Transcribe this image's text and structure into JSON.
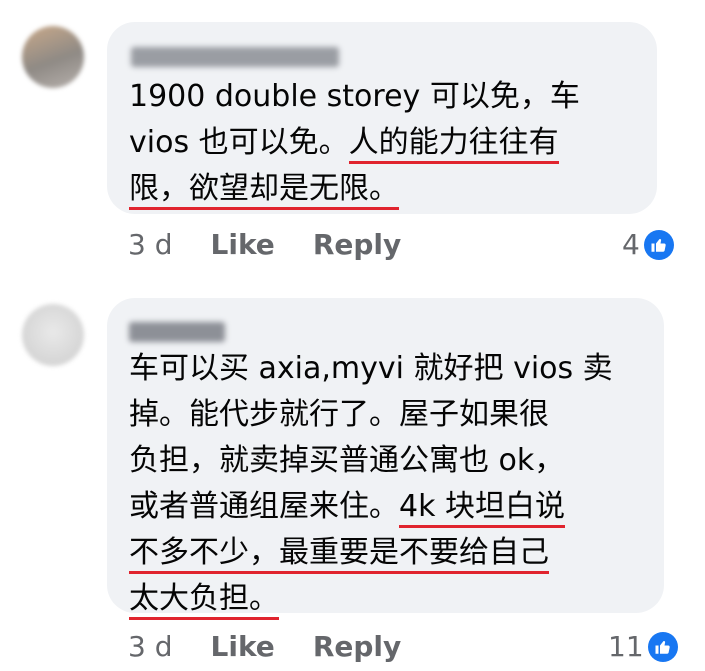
{
  "comments": [
    {
      "text_lines": [
        {
          "parts": [
            {
              "text": "1900 double storey 可以免，车"
            }
          ]
        },
        {
          "parts": [
            {
              "text": "vios 也可以免。"
            },
            {
              "text": "人的能力往往有",
              "highlight": true
            }
          ]
        },
        {
          "parts": [
            {
              "text": "限，欲望却是无限。",
              "highlight": true
            }
          ]
        }
      ],
      "age": "3 d",
      "like_label": "Like",
      "reply_label": "Reply",
      "reaction_count": "4",
      "reaction_icon": "like-thumb-icon",
      "colors": {
        "avatar": [
          "#c9a98a",
          "#8f8a85",
          "#b7b1ad"
        ],
        "author": "#9a9da3"
      }
    },
    {
      "text_lines": [
        {
          "parts": [
            {
              "text": "车可以买 axia,myvi 就好把 vios 卖"
            }
          ]
        },
        {
          "parts": [
            {
              "text": "掉。能代步就行了。屋子如果很"
            }
          ]
        },
        {
          "parts": [
            {
              "text": "负担，就卖掉买普通公寓也 ok，"
            }
          ]
        },
        {
          "parts": [
            {
              "text": "或者普通组屋来住。"
            },
            {
              "text": "4k 块坦白说",
              "highlight": true
            }
          ]
        },
        {
          "parts": [
            {
              "text": "不多不少，最重要是不要给自己",
              "highlight": true
            }
          ]
        },
        {
          "parts": [
            {
              "text": "太大负担。",
              "highlight": true
            }
          ]
        }
      ],
      "age": "3 d",
      "like_label": "Like",
      "reply_label": "Reply",
      "reaction_count": "11",
      "reaction_icon": "like-thumb-icon",
      "colors": {
        "avatar": [
          "#d8d8d8",
          "#e9e9e9",
          "#cfcfcf"
        ],
        "author": "#8d9097"
      }
    }
  ]
}
